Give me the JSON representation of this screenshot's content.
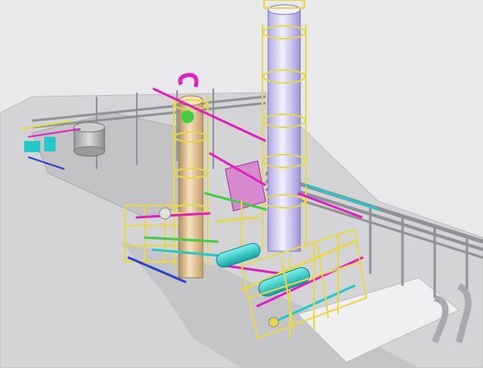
{
  "scene": {
    "subject": "plant-3d-model",
    "colors": {
      "background": "#e9e9eb",
      "ground": "#cfcfd2",
      "pipe_gray": "#8f9296",
      "steel_yellow": "#e6d84a",
      "pipe_magenta": "#e020c0",
      "pipe_cyan": "#21c9c9",
      "pipe_green": "#44cc44",
      "pipe_blue": "#2a46c8",
      "tower_tan": "#e8c99a",
      "tower_lavender": "#cfc7ef"
    }
  }
}
